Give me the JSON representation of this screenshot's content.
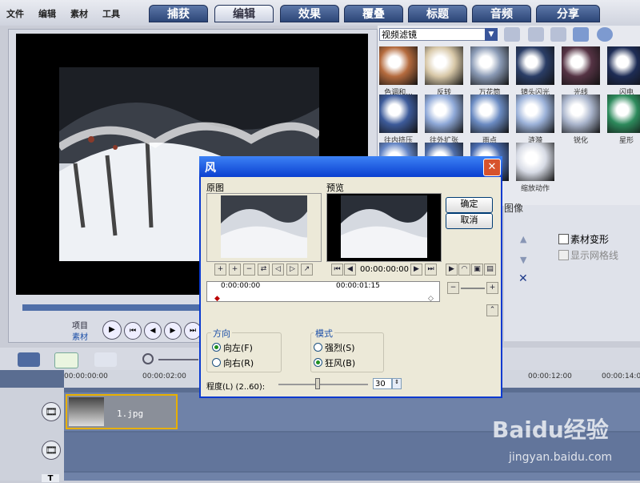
{
  "menu": [
    "文件",
    "编辑",
    "素材",
    "工具"
  ],
  "tabs": [
    "捕获",
    "编辑",
    "效果",
    "覆叠",
    "标题",
    "音频",
    "分享"
  ],
  "active_tab": "编辑",
  "preview": {
    "project_label": "项目",
    "clip_label": "素材"
  },
  "library": {
    "selected": "视频滤镜",
    "effects": [
      {
        "label": "色调和..."
      },
      {
        "label": "反转"
      },
      {
        "label": "万花筒"
      },
      {
        "label": "镜头闪光"
      },
      {
        "label": "光线"
      },
      {
        "label": "闪电"
      },
      {
        "label": "往内挤压"
      },
      {
        "label": "往外扩张"
      },
      {
        "label": "雨点"
      },
      {
        "label": "涟漪"
      },
      {
        "label": "锐化"
      },
      {
        "label": "星形"
      },
      {
        "label": ""
      },
      {
        "label": ""
      },
      {
        "label": ""
      },
      {
        "label": "缩放动作"
      }
    ]
  },
  "attributes": {
    "image_label": "图像",
    "deform_label": "素材变形",
    "grid_label": "显示网格线"
  },
  "timeline": {
    "ruler": [
      "00:00:00:00",
      "00:00:02:00",
      "00:00:12:00",
      "00:00:14:0"
    ],
    "clip_name": "1.jpg"
  },
  "dialog": {
    "title": "风",
    "original_label": "原图",
    "preview_label": "预览",
    "ok": "确定",
    "cancel": "取消",
    "timecode": "00:00:00:00",
    "ruler_start": "0:00:00:00",
    "ruler_mid": "00:00:01:15",
    "direction_title": "方向",
    "dir_left": "向左(F)",
    "dir_right": "向右(R)",
    "mode_title": "模式",
    "mode_strong": "强烈(S)",
    "mode_gale": "狂风(B)",
    "degree_label": "程度(L) (2..60):",
    "degree_value": "30"
  },
  "watermark": {
    "brand": "Baidu经验",
    "url": "jingyan.baidu.com"
  }
}
